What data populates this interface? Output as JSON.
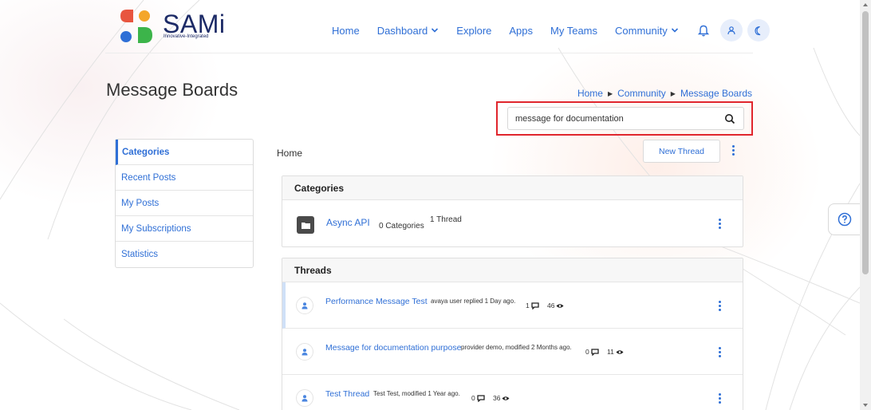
{
  "brand": {
    "name": "SAMi",
    "tagline": "Innovative-Integrated",
    "colors": {
      "red": "#e8553f",
      "orange": "#f4a62a",
      "blue": "#2f6fd6",
      "green": "#3cb44a",
      "navy": "#1c2a66"
    }
  },
  "nav": {
    "items": [
      {
        "label": "Home"
      },
      {
        "label": "Dashboard"
      },
      {
        "label": "Explore"
      },
      {
        "label": "Apps"
      },
      {
        "label": "My Teams"
      },
      {
        "label": "Community"
      }
    ],
    "bell_icon": "bell-icon",
    "user_icon": "user-icon",
    "theme_icon": "moon-icon"
  },
  "page": {
    "title": "Message Boards",
    "breadcrumb": [
      "Home",
      "Community",
      "Message Boards"
    ]
  },
  "search": {
    "value": "message for documentation",
    "icon": "search-icon",
    "highlight_color": "#e0262d"
  },
  "sidebar": {
    "items": [
      {
        "label": "Categories"
      },
      {
        "label": "Recent Posts"
      },
      {
        "label": "My Posts"
      },
      {
        "label": "My Subscriptions"
      },
      {
        "label": "Statistics"
      }
    ]
  },
  "main": {
    "home_label": "Home",
    "new_thread_label": "New Thread",
    "categories": {
      "heading": "Categories",
      "items": [
        {
          "name": "Async API",
          "count": "0 Categories",
          "threads": "1 Thread"
        }
      ]
    },
    "threads": {
      "heading": "Threads",
      "items": [
        {
          "title": "Performance Message Test",
          "meta": "avaya user replied 1 Day ago.",
          "replies": "1",
          "views": "46"
        },
        {
          "title": "Message for documentation purpose",
          "meta": "provider demo, modified 2 Months ago.",
          "replies": "0",
          "views": "11"
        },
        {
          "title": "Test Thread",
          "meta": "Test Test, modified 1 Year ago.",
          "replies": "0",
          "views": "36"
        }
      ]
    }
  },
  "help": {
    "icon": "help-icon"
  }
}
